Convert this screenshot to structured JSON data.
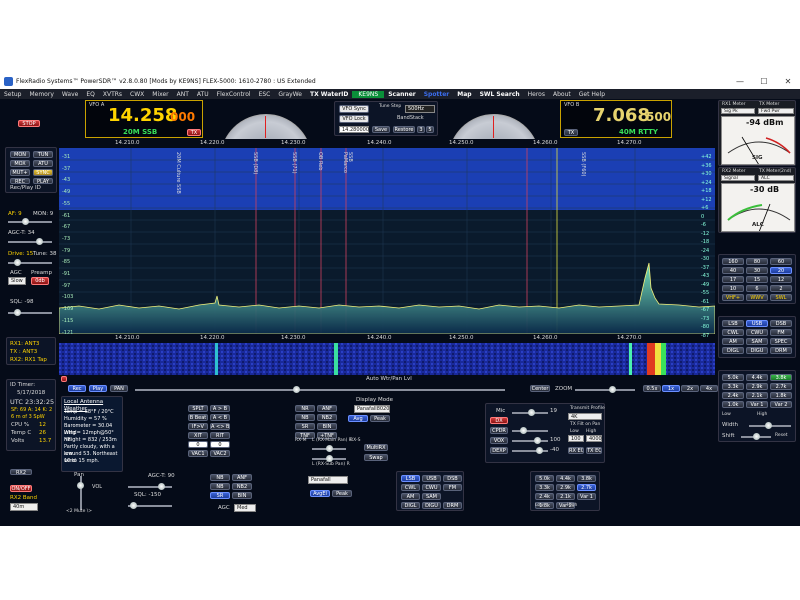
{
  "titlebar": {
    "title": "FlexRadio Systems™ PowerSDR™ v2.8.0.80   [Mods by KE9NS]   FLEX-5000: 1610-2780 : US Extended",
    "min": "—",
    "max": "☐",
    "close": "✕"
  },
  "menu": [
    "Setup",
    "Memory",
    "Wave",
    "EQ",
    "XVTRs",
    "CWX",
    "Mixer",
    "ANT",
    "ATU",
    "FlexControl",
    "ESC",
    "GrayWe"
  ],
  "menu_right": {
    "tx_waterid": "TX WaterID",
    "ke9ns": "KE9NS",
    "scanner": "Scanner",
    "spotter": "Spotter",
    "map": "Map",
    "swl": "SWL Search",
    "heros": "Heros",
    "about": "About",
    "gethelp": "Get Help"
  },
  "left": {
    "stop": "STOP",
    "mode_btns": [
      "MON",
      "TUN",
      "MOX",
      "ATU",
      "MUT+",
      "SYNC",
      "REC",
      "PLAY"
    ],
    "rec_play": "Rec/Play ID",
    "af": "AF: 9",
    "mon": "MON: 9",
    "agc_t": "AGC-T: 34",
    "drive": "Drive: 15",
    "tune": "Tune: 38",
    "agc": "AGC",
    "preamp": "Preamp",
    "agc_val": "Slow",
    "preamp_val": "0db",
    "sql": "SQL: -98",
    "ant": [
      "RX1: ANT3",
      "TX : ANT3",
      "RX2: RX1 Tap"
    ],
    "id_timer": "ID Timer:",
    "id_timer_val": "",
    "date": "5/17/2018",
    "utc": "UTC  23:32:25",
    "sf": "SF: 69  A: 14  K: 2",
    "sw": "6 m of 3 SpW",
    "cpu": "CPU %",
    "cpu_val": "12",
    "temp": "Temp C",
    "temp_val": "26",
    "volts": "Volts",
    "volts_val": "13.7",
    "rx2": "RX2",
    "rx2_on": "ON/OFF",
    "rx2_band": "RX2 Band",
    "rx2_band_val": "40m"
  },
  "vfoa": {
    "label": "VFO A",
    "freq_main": "14.258",
    "freq_sub": "000",
    "mode": "20M SSB",
    "tx": "TX"
  },
  "vfob": {
    "label": "VFO B",
    "freq_main": "7.068",
    "freq_sub": "500",
    "mode": "40M RTTY",
    "tx": "TX"
  },
  "center": {
    "vfo_sync": "VFO Sync",
    "vfo_lock": "VFO Lock",
    "tune_step": "Tune Step",
    "step_val": "500Hz",
    "bandstack": "BandStack",
    "freq_small": "14.280000",
    "save": "Save",
    "restore": "Restore",
    "bs_a": "3",
    "bs_b": "5"
  },
  "spectrum": {
    "freq_ticks": [
      "14.210.0",
      "14.220.0",
      "14.230.0",
      "14.240.0",
      "14.250.0",
      "14.260.0",
      "14.270.0"
    ],
    "db_left": [
      "-31",
      "-37",
      "-43",
      "-49",
      "-55",
      "-61",
      "-67",
      "-73",
      "-79",
      "-85",
      "-91",
      "-97",
      "-103",
      "-109",
      "-115",
      "-121"
    ],
    "db_right": [
      "+42",
      "+36",
      "+30",
      "+24",
      "+18",
      "+12",
      "+6",
      "0",
      "-6",
      "-12",
      "-18",
      "-24",
      "-30",
      "-37",
      "-43",
      "-49",
      "-55",
      "-61",
      "-67",
      "-73",
      "-80",
      "-87"
    ],
    "spots": [
      "20M Culture SSB",
      "SSB (D8)",
      "SSB (71)",
      "OB Reb",
      "PaMarco",
      "SSB",
      "SSB (F60)"
    ],
    "wf_ticks": [
      "14.210.0",
      "14.220.0",
      "14.230.0",
      "14.240.0",
      "14.250.0",
      "14.260.0",
      "14.270.0"
    ]
  },
  "bottom": {
    "rx_btns": [
      "Rec",
      "Play",
      "PAN"
    ],
    "auto_wf": "Auto Wtr/Pan Lvl",
    "center": "Center",
    "zoom": "ZOOM",
    "zoom_btns": [
      "0.5x",
      "1x",
      "2x",
      "4x"
    ],
    "weather_title": "Local Antenna Weather",
    "weather": [
      "Temp = 68°F / 20°C",
      "Humidity = 57 %",
      "Barometer = 30.04 inHg",
      "Wind= 12mph@50° NE",
      "Height = 832 / 253m",
      "Partly cloudy, with a low",
      "around 53. Northeast wind",
      "10 to 15 mph."
    ],
    "split": [
      "SPLT",
      "A > B",
      "B Beat",
      "A < B",
      "IF>V",
      "A <> B",
      "XIT",
      "RIT",
      "0",
      "0",
      "VAC1",
      "VAC2"
    ],
    "nr": [
      "NR",
      "ANF",
      "NB",
      "NB2",
      "SR",
      "BIN",
      "TNF",
      "+TNF"
    ],
    "rx_mix": [
      "RX-M",
      "L (RX-Main Pan) R",
      "RX-S",
      "MultiRX",
      "Swap",
      "L (RX-Sub Pan) R"
    ],
    "display_mode": "Display Mode",
    "display_val": "Panafall8020",
    "avg": "Avg",
    "peak": "Peak",
    "agc_t2": "AGC-T: 90",
    "sql2": "SQL: -150",
    "nr2": [
      "NB",
      "ANF",
      "NB",
      "NB2",
      "SR",
      "BIN"
    ],
    "agc2": "AGC",
    "agc2_val": "Med",
    "display2": "Panafall",
    "avg2": "AvgEl",
    "peak2": "Peak",
    "vol": "VOL",
    "pan": "Pan",
    "mute": "<2 Mute \\>",
    "tx_panel": [
      "Mic",
      "DX",
      "CPDR",
      "VOX",
      "DEXP"
    ],
    "tx_vals": [
      "19",
      "",
      "",
      "100",
      "-40"
    ],
    "tx_profile": "Transmit Profile",
    "tx_profile_val": "4K",
    "tx_fil": "TX Filt on Pan",
    "low": "Low",
    "high": "High",
    "low_val": "100",
    "high_val": "4000",
    "rx_eq": "RX EQ",
    "tx_eq": "TX EQ",
    "mode2": [
      "LSB",
      "USB",
      "DSB",
      "CWL",
      "CWU",
      "FM",
      "AM",
      "SAM",
      "DIGL",
      "DIGU",
      "DRM"
    ],
    "filt2": [
      "5.0k",
      "4.4k",
      "3.8k",
      "3.3k",
      "2.9k",
      "2.7k",
      "2.4k",
      "2.1k",
      "Var 1",
      "1.8k",
      "Var 2"
    ],
    "filt2_low": "Low",
    "filt2_high": "High"
  },
  "right": {
    "rx1_meter": "RX1 Meter",
    "tx_meter": "TX Meter",
    "rx1_sel": "Sig Pk",
    "tx_sel": "Fwd Pwr",
    "dbm1": "-94 dBm",
    "sig": "SIG",
    "rx2_meter": "RX2 Meter",
    "tx_meter2": "TX Meter(2nd)",
    "rx2_sel": "Signal",
    "tx2_sel": "ALC",
    "dbm2": "-30 dB",
    "alc": "ALC",
    "bands": [
      "160",
      "80",
      "60",
      "40",
      "30",
      "20",
      "17",
      "15",
      "12",
      "10",
      "6",
      "2",
      "VHF+",
      "WWV",
      "SWL"
    ],
    "modes": [
      "LSB",
      "USB",
      "DSB",
      "CWL",
      "CWU",
      "FM",
      "AM",
      "SAM",
      "SPEC",
      "DIGL",
      "DIGU",
      "DRM"
    ],
    "filters": [
      "5.0k",
      "4.4k",
      "3.8k",
      "3.3k",
      "2.9k",
      "2.7k",
      "2.4k",
      "2.1k",
      "1.8k",
      "1.0k",
      "Var 1",
      "Var 2"
    ],
    "low": "Low",
    "high": "High",
    "width": "Width",
    "shift": "Shift",
    "reset": "Reset"
  },
  "colors": {
    "bg": "#050b18",
    "spec_top": "#1a3aa8",
    "trace": "#f2f07a",
    "accent": "#ffd400"
  }
}
